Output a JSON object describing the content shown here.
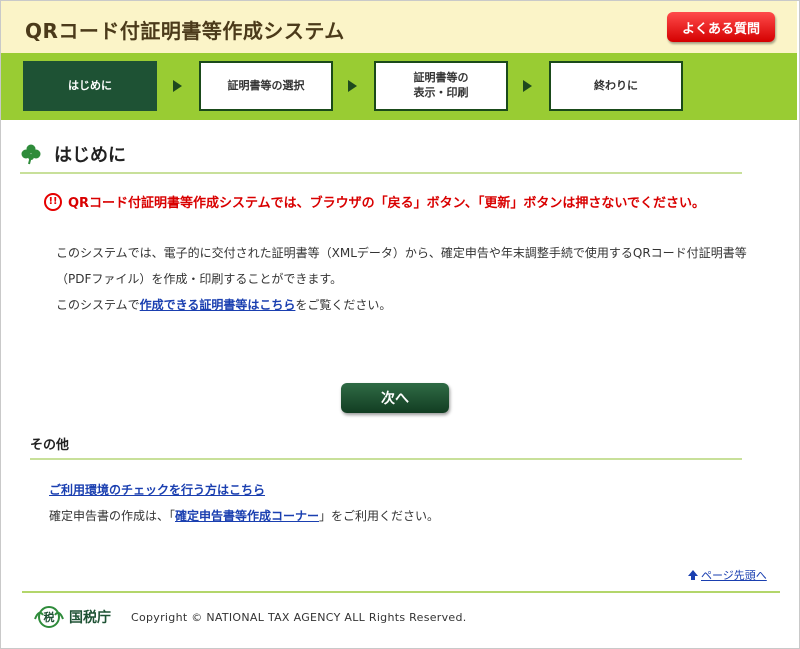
{
  "header": {
    "title": "QRコード付証明書等作成システム",
    "faq_label": "よくある質問"
  },
  "steps": [
    {
      "label": "はじめに",
      "active": true
    },
    {
      "label": "証明書等の選択",
      "active": false
    },
    {
      "label_line1": "証明書等の",
      "label_line2": "表示・印刷",
      "active": false
    },
    {
      "label": "終わりに",
      "active": false
    }
  ],
  "section": {
    "icon": "clover-icon",
    "title": "はじめに"
  },
  "warning": {
    "icon": "alert-icon",
    "text": "QRコード付証明書等作成システムでは、ブラウザの「戻る」ボタン、「更新」ボタンは押さないでください。"
  },
  "intro": {
    "line1": "このシステムでは、電子的に交付された証明書等（XMLデータ）から、確定申告や年末調整手続で使用するQRコード付証明書等",
    "line2": "（PDFファイル）を作成・印刷することができます。",
    "line3_prefix": "このシステムで",
    "line3_link": "作成できる証明書等はこちら",
    "line3_suffix": "をご覧ください。"
  },
  "next_button": "次へ",
  "other": {
    "heading": "その他",
    "env_link": "ご利用環境のチェックを行う方はこちら",
    "tax_prefix": "確定申告書の作成は、「",
    "tax_link": "確定申告書等作成コーナー",
    "tax_suffix": "」をご利用ください。"
  },
  "page_top": "ページ先頭へ",
  "footer": {
    "agency": "国税庁",
    "logo_char": "税",
    "copyright": "Copyright © NATIONAL TAX AGENCY ALL Rights Reserved."
  },
  "colors": {
    "header_bg": "#fbf4c8",
    "stepbar_bg": "#99cc33",
    "active_step": "#1e5234",
    "warning": "#d90000",
    "faq_button": "#e00000",
    "link": "#1a3fb0"
  }
}
